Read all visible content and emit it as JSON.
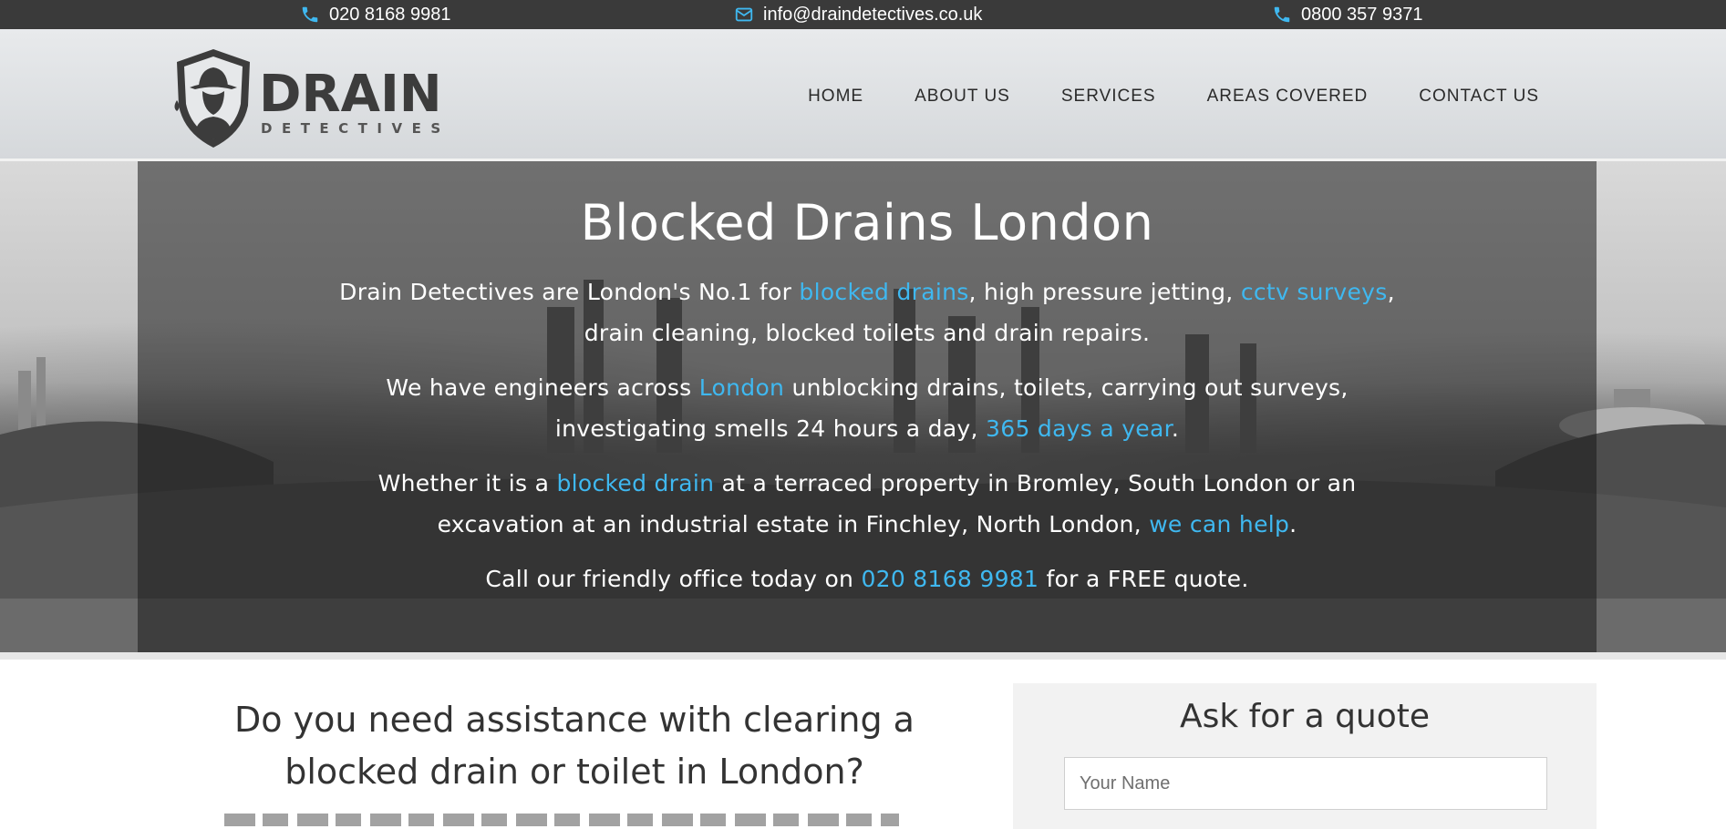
{
  "topbar": {
    "phone1": "020 8168 9981",
    "email": "info@draindetectives.co.uk",
    "phone2": "0800 357 9371",
    "icons": [
      "phone-icon",
      "envelope-icon",
      "phone-icon"
    ],
    "icon_color": "#3fb8f0"
  },
  "header": {
    "logo": {
      "word1": "DRAIN",
      "word2": "DETECTIVES"
    },
    "nav": [
      "HOME",
      "ABOUT US",
      "SERVICES",
      "AREAS COVERED",
      "CONTACT US"
    ]
  },
  "hero": {
    "title": "Blocked Drains London",
    "p1": {
      "t1": "Drain Detectives are London's No.1 for ",
      "l1": "blocked drains",
      "t2": ", high pressure jetting, ",
      "l2": "cctv surveys",
      "t3": ", drain cleaning, blocked toilets and drain repairs."
    },
    "p2": {
      "t1": "We have engineers across ",
      "l1": "London",
      "t2": " unblocking drains, toilets, carrying out surveys, investigating smells 24 hours a day, ",
      "l2": "365 days a year",
      "t3": "."
    },
    "p3": {
      "t1": "Whether it is a ",
      "l1": "blocked drain",
      "t2": " at a terraced property in Bromley, South London or an excavation at an industrial estate in Finchley, North London, ",
      "l2": "we can help",
      "t3": "."
    },
    "p4": {
      "t1": "Call our friendly office today on ",
      "l1": "020 8168 9981",
      "t2": " for a FREE quote."
    },
    "link_color": "#3fb8f0"
  },
  "main": {
    "question": "Do you need assistance with clearing a blocked drain or toilet in London?"
  },
  "quote": {
    "title": "Ask for a quote",
    "name_placeholder": "Your Name"
  }
}
